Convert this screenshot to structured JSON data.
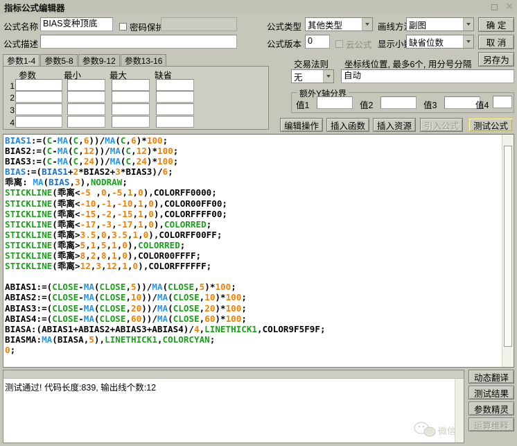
{
  "window": {
    "title": "指标公式编辑器",
    "maximize_icon": "square-icon",
    "close_icon": "close-icon"
  },
  "form": {
    "name_label": "公式名称",
    "name_value": "BIAS变种顶底",
    "password_protect_label": "密码保护",
    "password_value": "",
    "desc_label": "公式描述",
    "desc_value": "",
    "type_label": "公式类型",
    "type_value": "其他类型",
    "draw_label": "画线方法",
    "draw_value": "副图",
    "version_label": "公式版本",
    "version_value": "0",
    "cloud_label": "云公式",
    "decimal_label": "显示小数",
    "decimal_value": "缺省位数",
    "trade_rule_label": "交易法则",
    "trade_rule_value": "无",
    "axis_hint": "坐标线位置, 最多6个, 用分号分隔",
    "axis_value": "自动",
    "extra_axis_legend": "额外Y轴分界",
    "extra_axis": [
      {
        "label": "值1",
        "value": ""
      },
      {
        "label": "值2",
        "value": ""
      },
      {
        "label": "值3",
        "value": ""
      },
      {
        "label": "值4",
        "value": ""
      }
    ]
  },
  "side_buttons": {
    "ok": "确  定",
    "cancel": "取  消",
    "save_as": "另存为"
  },
  "action_buttons": [
    {
      "label": "编辑操作",
      "state": "normal"
    },
    {
      "label": "插入函数",
      "state": "normal"
    },
    {
      "label": "插入资源",
      "state": "normal"
    },
    {
      "label": "引入公式",
      "state": "disabled"
    },
    {
      "label": "测试公式",
      "state": "highlighted"
    }
  ],
  "params": {
    "tabs": [
      "参数1-4",
      "参数5-8",
      "参数9-12",
      "参数13-16"
    ],
    "active_tab": 0,
    "headers": [
      "参数",
      "最小",
      "最大",
      "缺省"
    ],
    "rows": [
      {
        "no": "1",
        "values": [
          "",
          "",
          "",
          ""
        ]
      },
      {
        "no": "2",
        "values": [
          "",
          "",
          "",
          ""
        ]
      },
      {
        "no": "3",
        "values": [
          "",
          "",
          "",
          ""
        ]
      },
      {
        "no": "4",
        "values": [
          "",
          "",
          "",
          ""
        ]
      }
    ]
  },
  "editor": {
    "lines": [
      [
        {
          "t": "BIAS1",
          "c": "tk-id"
        },
        {
          "t": ":=(",
          "c": "tk-b"
        },
        {
          "t": "C",
          "c": "tk-kw"
        },
        {
          "t": "-",
          "c": "tk-b"
        },
        {
          "t": "MA",
          "c": "tk-fn"
        },
        {
          "t": "(",
          "c": "tk-b"
        },
        {
          "t": "C",
          "c": "tk-kw"
        },
        {
          "t": ",",
          "c": "tk-b"
        },
        {
          "t": "6",
          "c": "tk-num"
        },
        {
          "t": "))/",
          "c": "tk-b"
        },
        {
          "t": "MA",
          "c": "tk-fn"
        },
        {
          "t": "(",
          "c": "tk-b"
        },
        {
          "t": "C",
          "c": "tk-kw"
        },
        {
          "t": ",",
          "c": "tk-b"
        },
        {
          "t": "6",
          "c": "tk-num"
        },
        {
          "t": ")*",
          "c": "tk-b"
        },
        {
          "t": "100",
          "c": "tk-num"
        },
        {
          "t": ";",
          "c": "tk-b"
        }
      ],
      [
        {
          "t": "BIAS2:=(",
          "c": "tk-b"
        },
        {
          "t": "C",
          "c": "tk-kw"
        },
        {
          "t": "-",
          "c": "tk-b"
        },
        {
          "t": "MA",
          "c": "tk-fn"
        },
        {
          "t": "(",
          "c": "tk-b"
        },
        {
          "t": "C",
          "c": "tk-kw"
        },
        {
          "t": ",",
          "c": "tk-b"
        },
        {
          "t": "12",
          "c": "tk-num"
        },
        {
          "t": "))/",
          "c": "tk-b"
        },
        {
          "t": "MA",
          "c": "tk-fn"
        },
        {
          "t": "(",
          "c": "tk-b"
        },
        {
          "t": "C",
          "c": "tk-kw"
        },
        {
          "t": ",",
          "c": "tk-b"
        },
        {
          "t": "12",
          "c": "tk-num"
        },
        {
          "t": ")*",
          "c": "tk-b"
        },
        {
          "t": "100",
          "c": "tk-num"
        },
        {
          "t": ";",
          "c": "tk-b"
        }
      ],
      [
        {
          "t": "BIAS3:=(",
          "c": "tk-b"
        },
        {
          "t": "C",
          "c": "tk-kw"
        },
        {
          "t": "-",
          "c": "tk-b"
        },
        {
          "t": "MA",
          "c": "tk-fn"
        },
        {
          "t": "(",
          "c": "tk-b"
        },
        {
          "t": "C",
          "c": "tk-kw"
        },
        {
          "t": ",",
          "c": "tk-b"
        },
        {
          "t": "24",
          "c": "tk-num"
        },
        {
          "t": "))/",
          "c": "tk-b"
        },
        {
          "t": "MA",
          "c": "tk-fn"
        },
        {
          "t": "(",
          "c": "tk-b"
        },
        {
          "t": "C",
          "c": "tk-kw"
        },
        {
          "t": ",",
          "c": "tk-b"
        },
        {
          "t": "24",
          "c": "tk-num"
        },
        {
          "t": ")*",
          "c": "tk-b"
        },
        {
          "t": "100",
          "c": "tk-num"
        },
        {
          "t": ";",
          "c": "tk-b"
        }
      ],
      [
        {
          "t": "BIAS",
          "c": "tk-id"
        },
        {
          "t": ":=(",
          "c": "tk-b"
        },
        {
          "t": "BIAS1",
          "c": "tk-blue"
        },
        {
          "t": "+",
          "c": "tk-b"
        },
        {
          "t": "2",
          "c": "tk-num"
        },
        {
          "t": "*BIAS2+",
          "c": "tk-b"
        },
        {
          "t": "3",
          "c": "tk-num"
        },
        {
          "t": "*BIAS3)/",
          "c": "tk-b"
        },
        {
          "t": "6",
          "c": "tk-num"
        },
        {
          "t": ";",
          "c": "tk-b"
        }
      ],
      [
        {
          "t": "乖离: ",
          "c": "tk-b"
        },
        {
          "t": "MA",
          "c": "tk-fn"
        },
        {
          "t": "(",
          "c": "tk-b"
        },
        {
          "t": "BIAS",
          "c": "tk-blue"
        },
        {
          "t": ",",
          "c": "tk-b"
        },
        {
          "t": "3",
          "c": "tk-num"
        },
        {
          "t": "),",
          "c": "tk-b"
        },
        {
          "t": "NODRAW",
          "c": "tk-kw"
        },
        {
          "t": ";",
          "c": "tk-b"
        }
      ],
      [
        {
          "t": "STICKLINE",
          "c": "tk-kw"
        },
        {
          "t": "(乖离<",
          "c": "tk-b"
        },
        {
          "t": "-5",
          "c": "tk-num"
        },
        {
          "t": " ,",
          "c": "tk-b"
        },
        {
          "t": "0",
          "c": "tk-num"
        },
        {
          "t": ",",
          "c": "tk-b"
        },
        {
          "t": "-5",
          "c": "tk-num"
        },
        {
          "t": ",",
          "c": "tk-b"
        },
        {
          "t": "1",
          "c": "tk-num"
        },
        {
          "t": ",",
          "c": "tk-b"
        },
        {
          "t": "0",
          "c": "tk-num"
        },
        {
          "t": "),COLORFF0000;",
          "c": "tk-b"
        }
      ],
      [
        {
          "t": "STICKLINE",
          "c": "tk-kw"
        },
        {
          "t": "(乖离<",
          "c": "tk-b"
        },
        {
          "t": "-10",
          "c": "tk-num"
        },
        {
          "t": ",",
          "c": "tk-b"
        },
        {
          "t": "-1",
          "c": "tk-num"
        },
        {
          "t": ",",
          "c": "tk-b"
        },
        {
          "t": "-10",
          "c": "tk-num"
        },
        {
          "t": ",",
          "c": "tk-b"
        },
        {
          "t": "1",
          "c": "tk-num"
        },
        {
          "t": ",",
          "c": "tk-b"
        },
        {
          "t": "0",
          "c": "tk-num"
        },
        {
          "t": "),COLOR00FF00;",
          "c": "tk-b"
        }
      ],
      [
        {
          "t": "STICKLINE",
          "c": "tk-kw"
        },
        {
          "t": "(乖离<",
          "c": "tk-b"
        },
        {
          "t": "-15",
          "c": "tk-num"
        },
        {
          "t": ",",
          "c": "tk-b"
        },
        {
          "t": "-2",
          "c": "tk-num"
        },
        {
          "t": ",",
          "c": "tk-b"
        },
        {
          "t": "-15",
          "c": "tk-num"
        },
        {
          "t": ",",
          "c": "tk-b"
        },
        {
          "t": "1",
          "c": "tk-num"
        },
        {
          "t": ",",
          "c": "tk-b"
        },
        {
          "t": "0",
          "c": "tk-num"
        },
        {
          "t": "),COLORFFFF00;",
          "c": "tk-b"
        }
      ],
      [
        {
          "t": "STICKLINE",
          "c": "tk-kw"
        },
        {
          "t": "(乖离<",
          "c": "tk-b"
        },
        {
          "t": "-17",
          "c": "tk-num"
        },
        {
          "t": ",",
          "c": "tk-b"
        },
        {
          "t": "-3",
          "c": "tk-num"
        },
        {
          "t": ",",
          "c": "tk-b"
        },
        {
          "t": "-17",
          "c": "tk-num"
        },
        {
          "t": ",",
          "c": "tk-b"
        },
        {
          "t": "1",
          "c": "tk-num"
        },
        {
          "t": ",",
          "c": "tk-b"
        },
        {
          "t": "0",
          "c": "tk-num"
        },
        {
          "t": "),",
          "c": "tk-b"
        },
        {
          "t": "COLORRED",
          "c": "tk-kw"
        },
        {
          "t": ";",
          "c": "tk-b"
        }
      ],
      [
        {
          "t": "STICKLINE",
          "c": "tk-kw"
        },
        {
          "t": "(乖离>",
          "c": "tk-b"
        },
        {
          "t": "3.5",
          "c": "tk-num"
        },
        {
          "t": ",",
          "c": "tk-b"
        },
        {
          "t": "0",
          "c": "tk-num"
        },
        {
          "t": ",",
          "c": "tk-b"
        },
        {
          "t": "3.5",
          "c": "tk-num"
        },
        {
          "t": ",",
          "c": "tk-b"
        },
        {
          "t": "1",
          "c": "tk-num"
        },
        {
          "t": ",",
          "c": "tk-b"
        },
        {
          "t": "0",
          "c": "tk-num"
        },
        {
          "t": "),COLORFF00FF;",
          "c": "tk-b"
        }
      ],
      [
        {
          "t": "STICKLINE",
          "c": "tk-kw"
        },
        {
          "t": "(乖离>",
          "c": "tk-b"
        },
        {
          "t": "5",
          "c": "tk-num"
        },
        {
          "t": ",",
          "c": "tk-b"
        },
        {
          "t": "1",
          "c": "tk-num"
        },
        {
          "t": ",",
          "c": "tk-b"
        },
        {
          "t": "5",
          "c": "tk-num"
        },
        {
          "t": ",",
          "c": "tk-b"
        },
        {
          "t": "1",
          "c": "tk-num"
        },
        {
          "t": ",",
          "c": "tk-b"
        },
        {
          "t": "0",
          "c": "tk-num"
        },
        {
          "t": "),",
          "c": "tk-b"
        },
        {
          "t": "COLORRED",
          "c": "tk-kw"
        },
        {
          "t": ";",
          "c": "tk-b"
        }
      ],
      [
        {
          "t": "STICKLINE",
          "c": "tk-kw"
        },
        {
          "t": "(乖离>",
          "c": "tk-b"
        },
        {
          "t": "8",
          "c": "tk-num"
        },
        {
          "t": ",",
          "c": "tk-b"
        },
        {
          "t": "2",
          "c": "tk-num"
        },
        {
          "t": ",",
          "c": "tk-b"
        },
        {
          "t": "8",
          "c": "tk-num"
        },
        {
          "t": ",",
          "c": "tk-b"
        },
        {
          "t": "1",
          "c": "tk-num"
        },
        {
          "t": ",",
          "c": "tk-b"
        },
        {
          "t": "0",
          "c": "tk-num"
        },
        {
          "t": "),COLOR00FFFF;",
          "c": "tk-b"
        }
      ],
      [
        {
          "t": "STICKLINE",
          "c": "tk-kw"
        },
        {
          "t": "(乖离>",
          "c": "tk-b"
        },
        {
          "t": "12",
          "c": "tk-num"
        },
        {
          "t": ",",
          "c": "tk-b"
        },
        {
          "t": "3",
          "c": "tk-num"
        },
        {
          "t": ",",
          "c": "tk-b"
        },
        {
          "t": "12",
          "c": "tk-num"
        },
        {
          "t": ",",
          "c": "tk-b"
        },
        {
          "t": "1",
          "c": "tk-num"
        },
        {
          "t": ",",
          "c": "tk-b"
        },
        {
          "t": "0",
          "c": "tk-num"
        },
        {
          "t": "),COLORFFFFFF;",
          "c": "tk-b"
        }
      ],
      [],
      [
        {
          "t": "ABIAS1:=(",
          "c": "tk-b"
        },
        {
          "t": "CLOSE",
          "c": "tk-kw"
        },
        {
          "t": "-",
          "c": "tk-b"
        },
        {
          "t": "MA",
          "c": "tk-fn"
        },
        {
          "t": "(",
          "c": "tk-b"
        },
        {
          "t": "CLOSE",
          "c": "tk-kw"
        },
        {
          "t": ",",
          "c": "tk-b"
        },
        {
          "t": "5",
          "c": "tk-num"
        },
        {
          "t": "))/",
          "c": "tk-b"
        },
        {
          "t": "MA",
          "c": "tk-fn"
        },
        {
          "t": "(",
          "c": "tk-b"
        },
        {
          "t": "CLOSE",
          "c": "tk-kw"
        },
        {
          "t": ",",
          "c": "tk-b"
        },
        {
          "t": "5",
          "c": "tk-num"
        },
        {
          "t": ")*",
          "c": "tk-b"
        },
        {
          "t": "100",
          "c": "tk-num"
        },
        {
          "t": ";",
          "c": "tk-b"
        }
      ],
      [
        {
          "t": "ABIAS2:=(",
          "c": "tk-b"
        },
        {
          "t": "CLOSE",
          "c": "tk-kw"
        },
        {
          "t": "-",
          "c": "tk-b"
        },
        {
          "t": "MA",
          "c": "tk-fn"
        },
        {
          "t": "(",
          "c": "tk-b"
        },
        {
          "t": "CLOSE",
          "c": "tk-kw"
        },
        {
          "t": ",",
          "c": "tk-b"
        },
        {
          "t": "10",
          "c": "tk-num"
        },
        {
          "t": "))/",
          "c": "tk-b"
        },
        {
          "t": "MA",
          "c": "tk-fn"
        },
        {
          "t": "(",
          "c": "tk-b"
        },
        {
          "t": "CLOSE",
          "c": "tk-kw"
        },
        {
          "t": ",",
          "c": "tk-b"
        },
        {
          "t": "10",
          "c": "tk-num"
        },
        {
          "t": ")*",
          "c": "tk-b"
        },
        {
          "t": "100",
          "c": "tk-num"
        },
        {
          "t": ";",
          "c": "tk-b"
        }
      ],
      [
        {
          "t": "ABIAS3:=(",
          "c": "tk-b"
        },
        {
          "t": "CLOSE",
          "c": "tk-kw"
        },
        {
          "t": "-",
          "c": "tk-b"
        },
        {
          "t": "MA",
          "c": "tk-fn"
        },
        {
          "t": "(",
          "c": "tk-b"
        },
        {
          "t": "CLOSE",
          "c": "tk-kw"
        },
        {
          "t": ",",
          "c": "tk-b"
        },
        {
          "t": "20",
          "c": "tk-num"
        },
        {
          "t": "))/",
          "c": "tk-b"
        },
        {
          "t": "MA",
          "c": "tk-fn"
        },
        {
          "t": "(",
          "c": "tk-b"
        },
        {
          "t": "CLOSE",
          "c": "tk-kw"
        },
        {
          "t": ",",
          "c": "tk-b"
        },
        {
          "t": "20",
          "c": "tk-num"
        },
        {
          "t": ")*",
          "c": "tk-b"
        },
        {
          "t": "100",
          "c": "tk-num"
        },
        {
          "t": ";",
          "c": "tk-b"
        }
      ],
      [
        {
          "t": "ABIAS4:=(",
          "c": "tk-b"
        },
        {
          "t": "CLOSE",
          "c": "tk-kw"
        },
        {
          "t": "-",
          "c": "tk-b"
        },
        {
          "t": "MA",
          "c": "tk-fn"
        },
        {
          "t": "(",
          "c": "tk-b"
        },
        {
          "t": "CLOSE",
          "c": "tk-kw"
        },
        {
          "t": ",",
          "c": "tk-b"
        },
        {
          "t": "60",
          "c": "tk-num"
        },
        {
          "t": "))/",
          "c": "tk-b"
        },
        {
          "t": "MA",
          "c": "tk-fn"
        },
        {
          "t": "(",
          "c": "tk-b"
        },
        {
          "t": "CLOSE",
          "c": "tk-kw"
        },
        {
          "t": ",",
          "c": "tk-b"
        },
        {
          "t": "60",
          "c": "tk-num"
        },
        {
          "t": ")*",
          "c": "tk-b"
        },
        {
          "t": "100",
          "c": "tk-num"
        },
        {
          "t": ";",
          "c": "tk-b"
        }
      ],
      [
        {
          "t": "BIASA:(ABIAS1+ABIAS2+ABIAS3+ABIAS4)/",
          "c": "tk-b"
        },
        {
          "t": "4",
          "c": "tk-num"
        },
        {
          "t": ",",
          "c": "tk-b"
        },
        {
          "t": "LINETHICK1",
          "c": "tk-kw"
        },
        {
          "t": ",COLOR9F5F9F;",
          "c": "tk-b"
        }
      ],
      [
        {
          "t": "BIASMA:",
          "c": "tk-b"
        },
        {
          "t": "MA",
          "c": "tk-fn"
        },
        {
          "t": "(BIASA,",
          "c": "tk-b"
        },
        {
          "t": "5",
          "c": "tk-num"
        },
        {
          "t": "),",
          "c": "tk-b"
        },
        {
          "t": "LINETHICK1",
          "c": "tk-kw"
        },
        {
          "t": ",",
          "c": "tk-b"
        },
        {
          "t": "COLORCYAN",
          "c": "tk-kw"
        },
        {
          "t": ";",
          "c": "tk-b"
        }
      ],
      [
        {
          "t": "0",
          "c": "tk-num"
        },
        {
          "t": ";",
          "c": "tk-b"
        }
      ]
    ]
  },
  "output": {
    "status_text": "测试通过!  代码长度:839, 输出线个数:12"
  },
  "right_buttons": [
    {
      "label": "动态翻译",
      "state": "normal"
    },
    {
      "label": "测试结果",
      "state": "normal"
    },
    {
      "label": "参数精灵",
      "state": "normal"
    },
    {
      "label": "运算维释",
      "state": "disabled"
    }
  ],
  "watermark": {
    "text": "微信",
    "icon": "wechat-icon"
  },
  "colors": {
    "window_bg": "#c7c6bb",
    "title_bg": "#c2c1b6",
    "editor_bg": "#ffffff",
    "keyword": "#1aa11a",
    "number": "#f08000",
    "function": "#2196f3",
    "identifier": "#1f7fe0",
    "highlight_border": "#d9d06a"
  }
}
